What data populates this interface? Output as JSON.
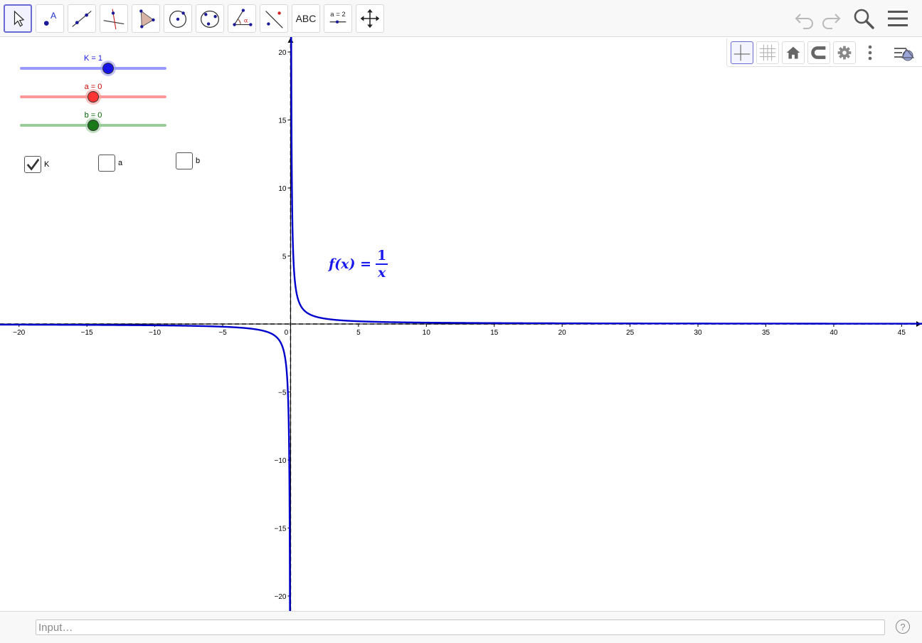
{
  "toolbar": {
    "tools": [
      {
        "name": "move-tool",
        "icon": "arrow-cursor-icon"
      },
      {
        "name": "point-tool",
        "icon": "point-icon",
        "glyph": "A"
      },
      {
        "name": "line-tool",
        "icon": "line-icon"
      },
      {
        "name": "perpendicular-line-tool",
        "icon": "perpendicular-icon"
      },
      {
        "name": "polygon-tool",
        "icon": "polygon-icon"
      },
      {
        "name": "circle-center-point-tool",
        "icon": "circle-center-icon"
      },
      {
        "name": "conic-tool",
        "icon": "ellipse-icon"
      },
      {
        "name": "angle-tool",
        "icon": "angle-icon",
        "glyph": "α"
      },
      {
        "name": "reflect-tool",
        "icon": "reflect-icon"
      },
      {
        "name": "text-tool",
        "icon": "text-icon",
        "label": "ABC"
      },
      {
        "name": "slider-tool",
        "icon": "slider-icon",
        "label": "a = 2"
      },
      {
        "name": "move-graphics-view-tool",
        "icon": "move-arrows-icon"
      }
    ],
    "right_icons": [
      "undo-icon",
      "redo-icon",
      "search-icon",
      "menu-icon"
    ]
  },
  "stylebar": {
    "icons": [
      "axes-icon",
      "grid-icon",
      "home-icon",
      "magnet-icon",
      "gear-icon",
      "more-vert-icon",
      "style-toggle-icon"
    ]
  },
  "sliders": [
    {
      "label": "K = 1",
      "color": "#1414e6",
      "track": "#9999ff",
      "knob": "#1414e6",
      "value_fraction": 0.6
    },
    {
      "label": "a = 0",
      "color": "#cc0000",
      "track": "#ff9999",
      "knob": "#ff3333",
      "value_fraction": 0.5
    },
    {
      "label": "b = 0",
      "color": "#006400",
      "track": "#99cc99",
      "knob": "#1a7a1a",
      "value_fraction": 0.5
    }
  ],
  "checkboxes": [
    {
      "label": "K",
      "checked": true
    },
    {
      "label": "a",
      "checked": false
    },
    {
      "label": "b",
      "checked": false
    }
  ],
  "formula": {
    "lhs": "f(x) =",
    "numerator": "1",
    "denominator": "x",
    "color": "#1a1aee"
  },
  "chart_data": {
    "type": "line",
    "series": [
      {
        "name": "f(x) = 1/x",
        "function": "1/x",
        "color": "#0000cc"
      }
    ],
    "asymptotes": [
      {
        "type": "vertical",
        "x": 0
      },
      {
        "type": "horizontal",
        "y": 0
      }
    ],
    "xlim": [
      -21.4,
      46.5
    ],
    "ylim": [
      -21.1,
      21.1
    ],
    "x_ticks": [
      -20,
      -15,
      -10,
      -5,
      0,
      5,
      10,
      15,
      20,
      25,
      30,
      35,
      40,
      45
    ],
    "y_ticks": [
      -20,
      -15,
      -10,
      -5,
      5,
      10,
      15,
      20
    ],
    "x_tick_labels": [
      "−20",
      "−15",
      "−10",
      "−5",
      "0",
      "5",
      "10",
      "15",
      "20",
      "25",
      "30",
      "35",
      "40",
      "45"
    ],
    "y_tick_labels": [
      "−20",
      "−15",
      "−10",
      "−5",
      "5",
      "10",
      "15",
      "20"
    ],
    "grid": false
  },
  "input": {
    "placeholder": "Input…"
  },
  "help_glyph": "?"
}
